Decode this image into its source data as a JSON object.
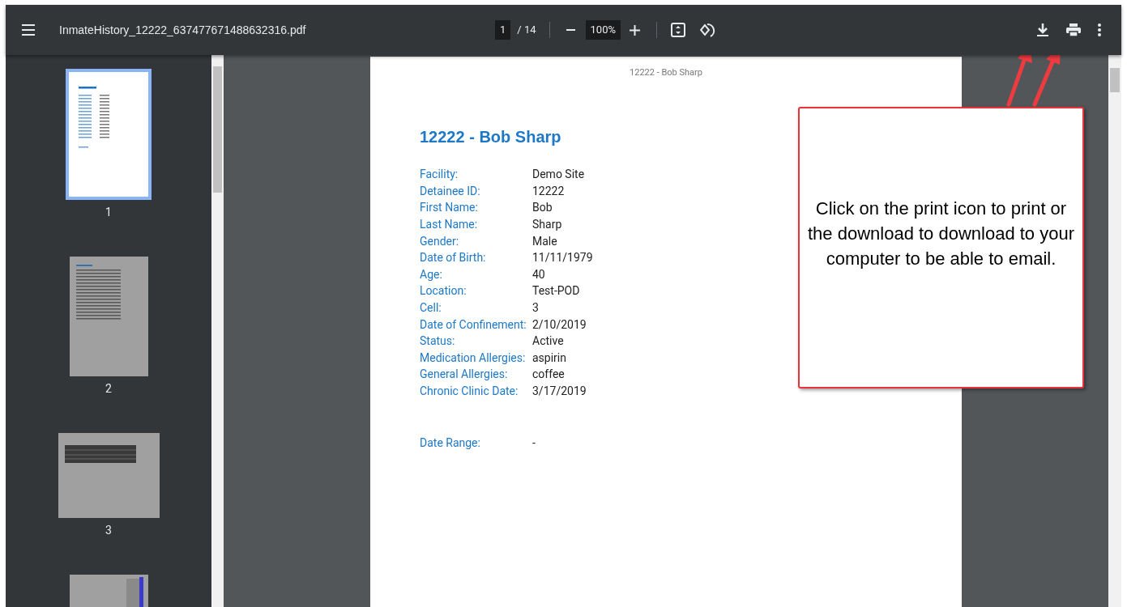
{
  "toolbar": {
    "title": "InmateHistory_12222_637477671488632316.pdf",
    "page_current": "1",
    "page_total": "/ 14",
    "zoom": "100%"
  },
  "thumbnails": [
    {
      "kind": "portrait",
      "label": "1",
      "selected": true
    },
    {
      "kind": "portrait",
      "label": "2",
      "selected": false
    },
    {
      "kind": "landscape",
      "label": "3",
      "selected": false
    },
    {
      "kind": "portrait-cut",
      "selected": false
    }
  ],
  "page": {
    "header": "12222 - Bob Sharp",
    "title": "12222 - Bob Sharp",
    "fields": [
      {
        "label": "Facility:",
        "value": "Demo Site"
      },
      {
        "label": "Detainee ID:",
        "value": "12222"
      },
      {
        "label": "First Name:",
        "value": "Bob"
      },
      {
        "label": "Last Name:",
        "value": "Sharp"
      },
      {
        "label": "Gender:",
        "value": "Male"
      },
      {
        "label": "Date of Birth:",
        "value": "11/11/1979"
      },
      {
        "label": "Age:",
        "value": "40"
      },
      {
        "label": "Location:",
        "value": "Test-POD"
      },
      {
        "label": "Cell:",
        "value": "3"
      },
      {
        "label": "Date of Confinement:",
        "value": "2/10/2019"
      },
      {
        "label": "Status:",
        "value": "Active"
      },
      {
        "label": "Medication Allergies:",
        "value": "aspirin"
      },
      {
        "label": "General Allergies:",
        "value": "coffee"
      },
      {
        "label": "Chronic Clinic Date:",
        "value": "3/17/2019"
      }
    ],
    "date_range": {
      "label": "Date Range:",
      "value": "-"
    }
  },
  "callout": {
    "text": "Click on the print icon to print or the download to download to your computer to be able to email."
  }
}
